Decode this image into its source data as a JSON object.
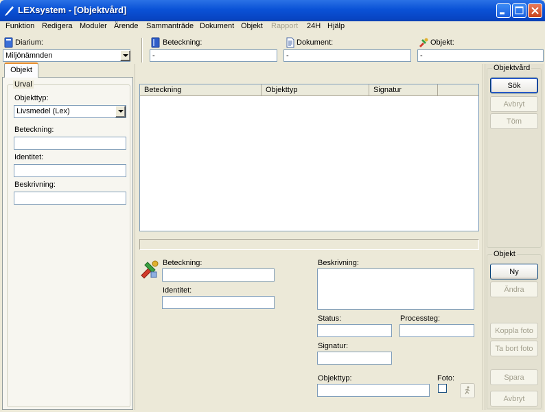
{
  "window": {
    "title": "LEXsystem - [Objektvård]",
    "controls": {
      "minimize": "minimize",
      "maximize": "maximize",
      "close": "close"
    }
  },
  "menu": [
    "Funktion",
    "Redigera",
    "Moduler",
    "Ärende",
    "Sammanträde",
    "Dokument",
    "Objekt",
    "Rapport",
    "24H",
    "Hjälp"
  ],
  "menu_disabled": [
    "Rapport"
  ],
  "toolbar": {
    "diarium_label": "Diarium:",
    "diarium_value": "Miljönämnden",
    "beteckning_label": "Beteckning:",
    "beteckning_value": "-",
    "dokument_label": "Dokument:",
    "dokument_value": "-",
    "objekt_label": "Objekt:",
    "objekt_value": "-"
  },
  "tab": {
    "label": "Objekt"
  },
  "urval": {
    "title": "Urval",
    "objekttyp_label": "Objekttyp:",
    "objekttyp_value": "Livsmedel (Lex)",
    "beteckning_label": "Beteckning:",
    "identitet_label": "Identitet:",
    "beskrivning_label": "Beskrivning:"
  },
  "list": {
    "columns": [
      "Beteckning",
      "Objekttyp",
      "Signatur",
      ""
    ]
  },
  "detail": {
    "beteckning_label": "Beteckning:",
    "identitet_label": "Identitet:",
    "beskrivning_label": "Beskrivning:",
    "status_label": "Status:",
    "processteg_label": "Processteg:",
    "signatur_label": "Signatur:",
    "objekttyp_label": "Objekttyp:",
    "foto_label": "Foto:"
  },
  "objektvard_group": {
    "title": "Objektvård",
    "sok": "Sök",
    "avbryt": "Avbryt",
    "tom": "Töm"
  },
  "objekt_group": {
    "title": "Objekt",
    "ny": "Ny",
    "andra": "Ändra",
    "koppla_foto": "Koppla foto",
    "ta_bort_foto": "Ta bort foto",
    "spara": "Spara",
    "avbryt": "Avbryt"
  }
}
